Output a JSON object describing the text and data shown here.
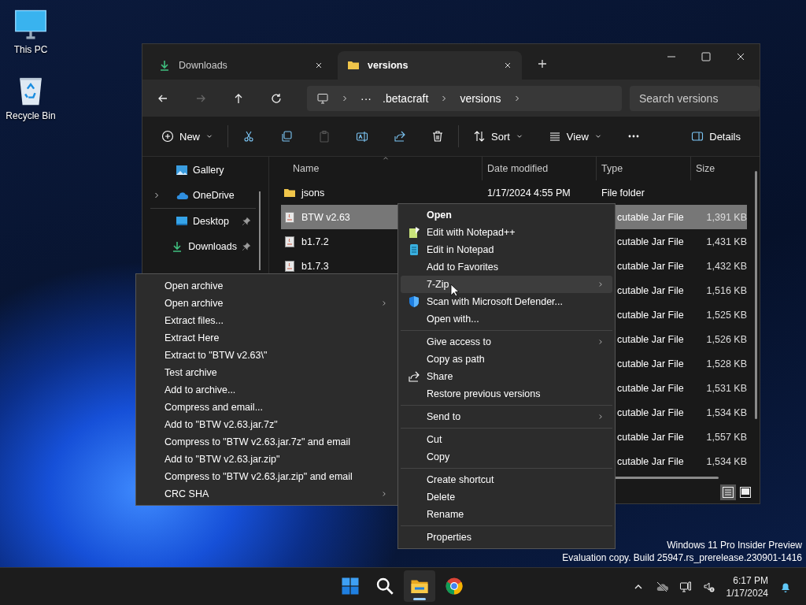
{
  "desktop_icons": [
    {
      "label": "This PC",
      "kind": "pc"
    },
    {
      "label": "Recycle Bin",
      "kind": "bin"
    }
  ],
  "window": {
    "tabs": [
      {
        "label": "Downloads",
        "kind": "download",
        "selected": false
      },
      {
        "label": "versions",
        "kind": "folder",
        "selected": true
      }
    ],
    "address": {
      "overflow": "···",
      "segments": [
        ".betacraft",
        "versions"
      ]
    },
    "search": {
      "placeholder": "Search versions"
    },
    "toolbar_groups": [
      [
        {
          "kind": "new",
          "label": "New",
          "dropdown": true,
          "disabled": false
        }
      ],
      [
        {
          "kind": "cut",
          "disabled": false
        },
        {
          "kind": "copy",
          "disabled": false
        },
        {
          "kind": "paste",
          "disabled": true
        },
        {
          "kind": "rename",
          "disabled": false
        },
        {
          "kind": "share",
          "disabled": false
        },
        {
          "kind": "delete",
          "disabled": false
        }
      ],
      [
        {
          "kind": "sort",
          "label": "Sort",
          "dropdown": true,
          "disabled": false
        },
        {
          "kind": "view",
          "label": "View",
          "dropdown": true,
          "disabled": false
        },
        {
          "kind": "more",
          "disabled": false
        }
      ]
    ],
    "details_button": {
      "label": "Details"
    },
    "sidebar": {
      "groups": [
        [
          {
            "label": "Gallery",
            "kind": "gallery",
            "expandable": false,
            "pinned": false
          },
          {
            "label": "OneDrive",
            "kind": "cloud",
            "expandable": true,
            "pinned": false
          }
        ],
        [
          {
            "label": "Desktop",
            "kind": "desktop",
            "expandable": false,
            "pinned": true
          },
          {
            "label": "Downloads",
            "kind": "download",
            "expandable": false,
            "pinned": true
          }
        ]
      ]
    },
    "columns": [
      {
        "label": "Name",
        "sorted": true
      },
      {
        "label": "Date modified",
        "sorted": false
      },
      {
        "label": "Type",
        "sorted": false
      },
      {
        "label": "Size",
        "sorted": false
      }
    ],
    "rows": [
      {
        "name": "jsons",
        "kind": "folder",
        "date": "1/17/2024 4:55 PM",
        "type": "File folder",
        "selected": false
      },
      {
        "name": "BTW v2.63",
        "kind": "jar",
        "type": "cutable Jar File",
        "size": "1,391 KB",
        "selected": true
      },
      {
        "name": "b1.7.2",
        "kind": "jar",
        "type": "cutable Jar File",
        "size": "1,431 KB",
        "selected": false
      },
      {
        "name": "b1.7.3",
        "kind": "jar",
        "type": "cutable Jar File",
        "size": "1,432 KB",
        "selected": false
      },
      {
        "type": "cutable Jar File",
        "size": "1,516 KB",
        "selected": false
      },
      {
        "type": "cutable Jar File",
        "size": "1,525 KB",
        "selected": false
      },
      {
        "type": "cutable Jar File",
        "size": "1,526 KB",
        "selected": false
      },
      {
        "type": "cutable Jar File",
        "size": "1,528 KB",
        "selected": false
      },
      {
        "type": "cutable Jar File",
        "size": "1,531 KB",
        "selected": false
      },
      {
        "type": "cutable Jar File",
        "size": "1,534 KB",
        "selected": false
      },
      {
        "type": "cutable Jar File",
        "size": "1,557 KB",
        "selected": false
      },
      {
        "type": "cutable Jar File",
        "size": "1,534 KB",
        "selected": false
      }
    ],
    "view_buttons": [
      {
        "kind": "details",
        "selected": true
      },
      {
        "kind": "tiles",
        "selected": false
      }
    ]
  },
  "context_menu": {
    "groups": [
      [
        {
          "label": "Open",
          "default": true,
          "submenu": false,
          "selected": false
        },
        {
          "label": "Edit with Notepad++",
          "kind": "notepadpp",
          "default": false,
          "submenu": false,
          "selected": false
        },
        {
          "label": "Edit in Notepad",
          "kind": "notepad",
          "default": false,
          "submenu": false,
          "selected": false
        },
        {
          "label": "Add to Favorites",
          "default": false,
          "submenu": false,
          "selected": false
        },
        {
          "label": "7-Zip",
          "default": false,
          "submenu": true,
          "selected": true
        },
        {
          "label": "Scan with Microsoft Defender...",
          "kind": "shield",
          "default": false,
          "submenu": false,
          "selected": false
        },
        {
          "label": "Open with...",
          "default": false,
          "submenu": false,
          "selected": false
        }
      ],
      [
        {
          "label": "Give access to",
          "default": false,
          "submenu": true,
          "selected": false
        },
        {
          "label": "Copy as path",
          "default": false,
          "submenu": false,
          "selected": false
        },
        {
          "label": "Share",
          "kind": "share",
          "default": false,
          "submenu": false,
          "selected": false
        },
        {
          "label": "Restore previous versions",
          "default": false,
          "submenu": false,
          "selected": false
        }
      ],
      [
        {
          "label": "Send to",
          "default": false,
          "submenu": true,
          "selected": false
        }
      ],
      [
        {
          "label": "Cut",
          "default": false,
          "submenu": false,
          "selected": false
        },
        {
          "label": "Copy",
          "default": false,
          "submenu": false,
          "selected": false
        }
      ],
      [
        {
          "label": "Create shortcut",
          "default": false,
          "submenu": false,
          "selected": false
        },
        {
          "label": "Delete",
          "default": false,
          "submenu": false,
          "selected": false
        },
        {
          "label": "Rename",
          "default": false,
          "submenu": false,
          "selected": false
        }
      ],
      [
        {
          "label": "Properties",
          "default": false,
          "submenu": false,
          "selected": false
        }
      ]
    ]
  },
  "submenu": {
    "items": [
      {
        "label": "Open archive",
        "submenu": false,
        "selected": false
      },
      {
        "label": "Open archive",
        "submenu": true,
        "selected": false
      },
      {
        "label": "Extract files...",
        "submenu": false,
        "selected": false
      },
      {
        "label": "Extract Here",
        "submenu": false,
        "selected": false
      },
      {
        "label": "Extract to \"BTW v2.63\\\"",
        "submenu": false,
        "selected": false
      },
      {
        "label": "Test archive",
        "submenu": false,
        "selected": false
      },
      {
        "label": "Add to archive...",
        "submenu": false,
        "selected": false
      },
      {
        "label": "Compress and email...",
        "submenu": false,
        "selected": false
      },
      {
        "label": "Add to \"BTW v2.63.jar.7z\"",
        "submenu": false,
        "selected": false
      },
      {
        "label": "Compress to \"BTW v2.63.jar.7z\" and email",
        "submenu": false,
        "selected": false
      },
      {
        "label": "Add to \"BTW v2.63.jar.zip\"",
        "submenu": false,
        "selected": false
      },
      {
        "label": "Compress to \"BTW v2.63.jar.zip\" and email",
        "submenu": false,
        "selected": false
      },
      {
        "label": "CRC SHA",
        "submenu": true,
        "selected": false
      }
    ]
  },
  "watermark": [
    "Windows 11 Pro Insider Preview",
    "Evaluation copy. Build 25947.rs_prerelease.230901-1416"
  ],
  "taskbar": {
    "apps": [
      {
        "kind": "start",
        "active": false
      },
      {
        "kind": "search",
        "active": false
      },
      {
        "kind": "explorer",
        "active": true
      },
      {
        "kind": "chrome",
        "active": false
      }
    ],
    "clock": {
      "time": "6:17 PM",
      "date": "1/17/2024"
    }
  }
}
